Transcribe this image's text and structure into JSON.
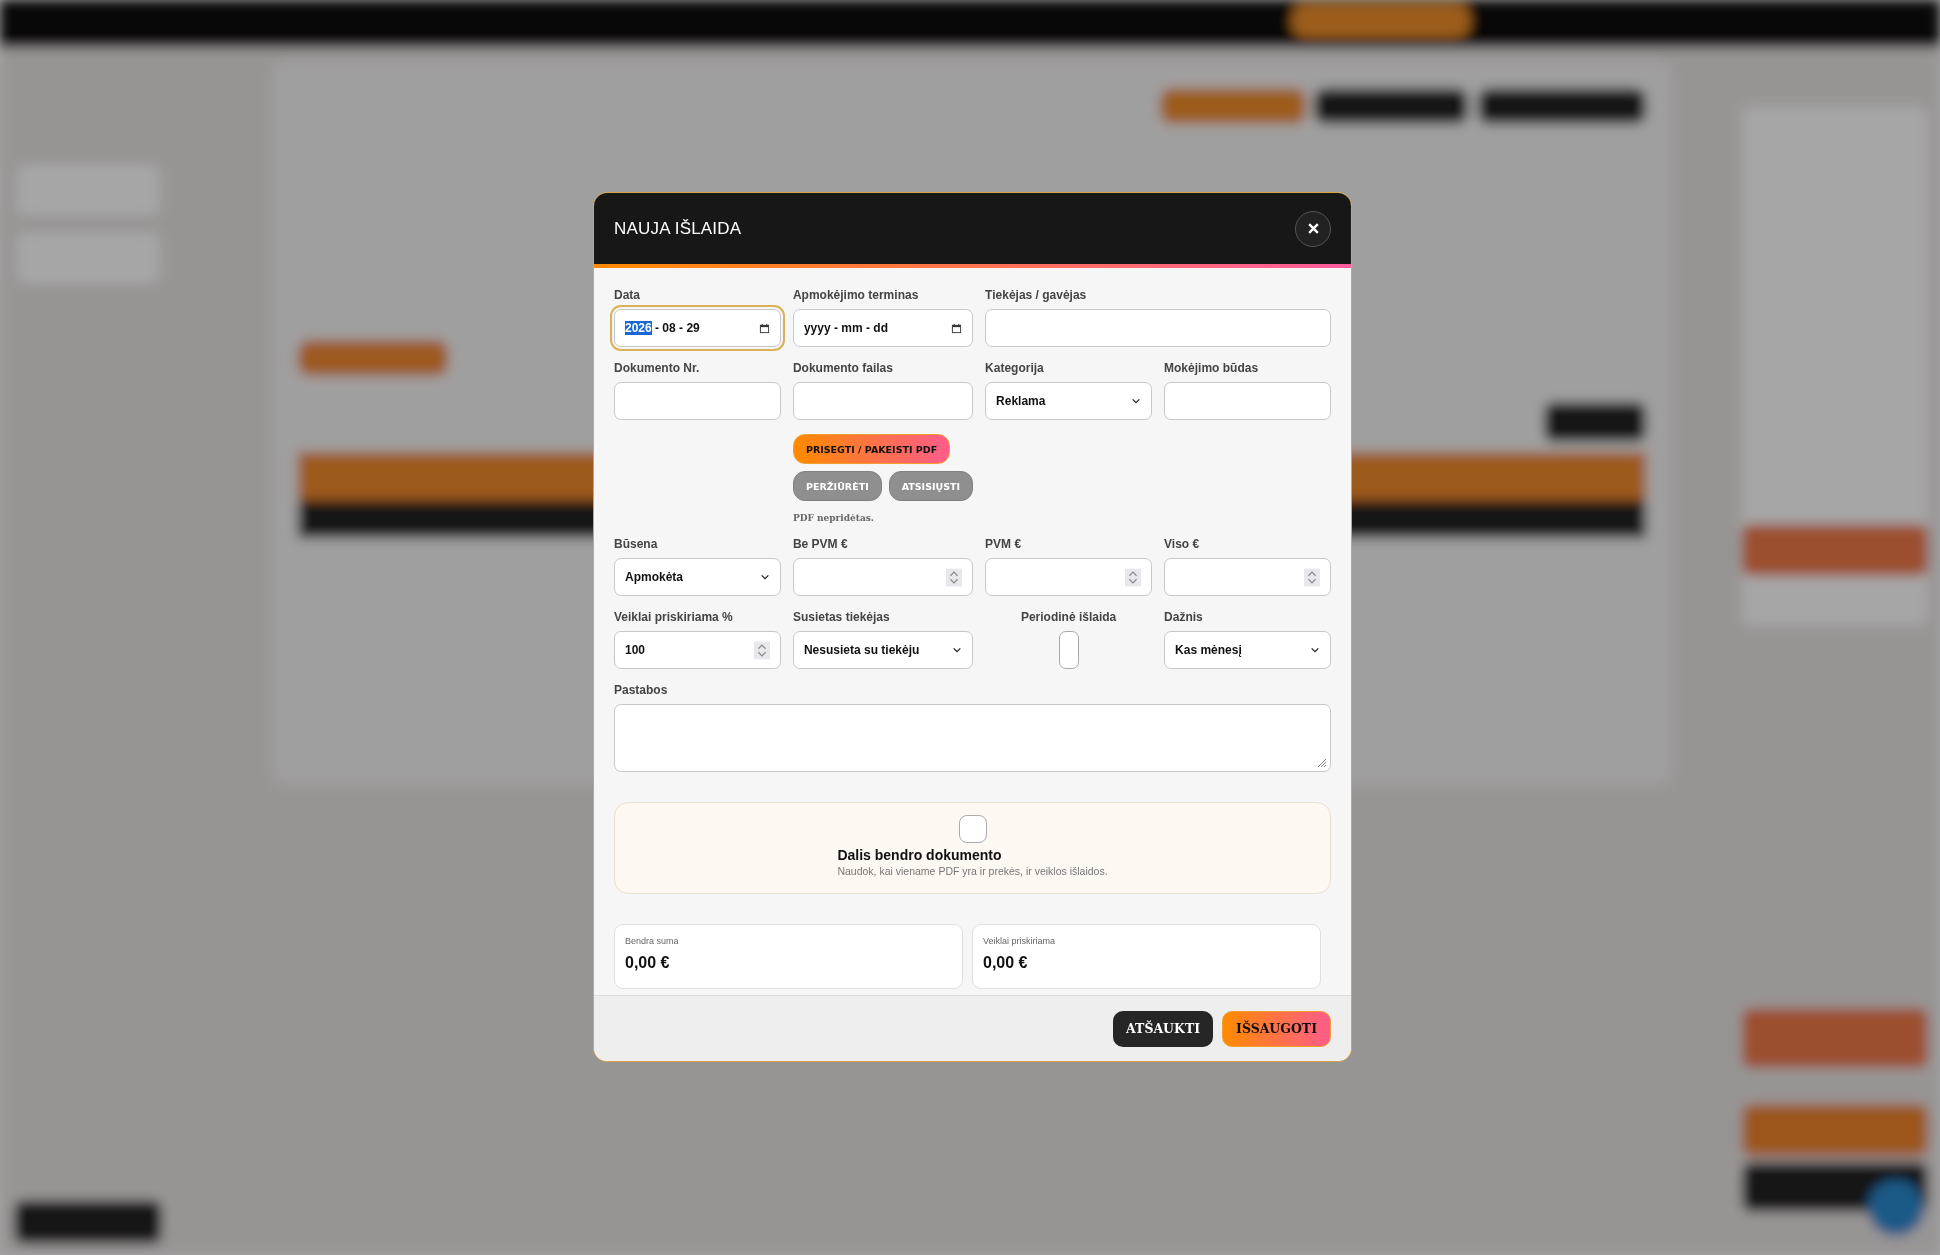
{
  "dialog": {
    "title": "NAUJA IŠLAIDA",
    "fields": [
      {
        "kind": "date",
        "label": "Data",
        "focused": true,
        "segments": [
          {
            "text": "2026",
            "selected": true
          },
          {
            "text": " - 08 - 29",
            "selected": false
          }
        ]
      },
      {
        "kind": "date",
        "label": "Apmokėjimo terminas",
        "focused": false,
        "placeholder": "yyyy - mm - dd"
      },
      {
        "kind": "text",
        "label": "Tiekėjas / gavėjas",
        "wide": true
      },
      {
        "kind": "text",
        "label": "Dokumento Nr."
      },
      {
        "kind": "file",
        "label": "Dokumento failas",
        "buttons": [
          {
            "label": "PRISEGTI / PAKEISTI PDF",
            "kind": "primary",
            "disabled": false
          },
          {
            "label": "PERŽIŪRĖTI",
            "kind": "secondary",
            "disabled": true
          },
          {
            "label": "ATSISIŲSTI",
            "kind": "secondary",
            "disabled": true
          }
        ],
        "note": "PDF nepridėtas."
      },
      {
        "kind": "select",
        "label": "Kategorija",
        "value": "Reklama"
      },
      {
        "kind": "text",
        "label": "Mokėjimo būdas"
      },
      {
        "kind": "select",
        "label": "Būsena",
        "value": "Apmokėta"
      },
      {
        "kind": "number",
        "label": "Be PVM €"
      },
      {
        "kind": "number",
        "label": "PVM €"
      },
      {
        "kind": "number",
        "label": "Viso €"
      },
      {
        "kind": "number",
        "label": "Veiklai priskiriama %",
        "value": "100"
      },
      {
        "kind": "select",
        "label": "Susietas tiekėjas",
        "value": "Nesusieta su tiekėju"
      },
      {
        "kind": "checkbox",
        "label": "Periodinė išlaida",
        "checked": false
      },
      {
        "kind": "select",
        "label": "Dažnis",
        "value": "Kas mėnesį"
      },
      {
        "kind": "textarea",
        "label": "Pastabos"
      }
    ],
    "shared_document": {
      "checked": false,
      "title": "Dalis bendro dokumento",
      "description": "Naudok, kai viename PDF yra ir prekės, ir veiklos išlaidos."
    },
    "summary": [
      {
        "label": "Bendra suma",
        "value": "0,00 €"
      },
      {
        "label": "Veiklai priskiriama",
        "value": "0,00 €"
      }
    ],
    "buttons": [
      {
        "label": "ATŠAUKTI",
        "kind": "secondary"
      },
      {
        "label": "IŠSAUGOTI",
        "kind": "primary"
      }
    ]
  }
}
